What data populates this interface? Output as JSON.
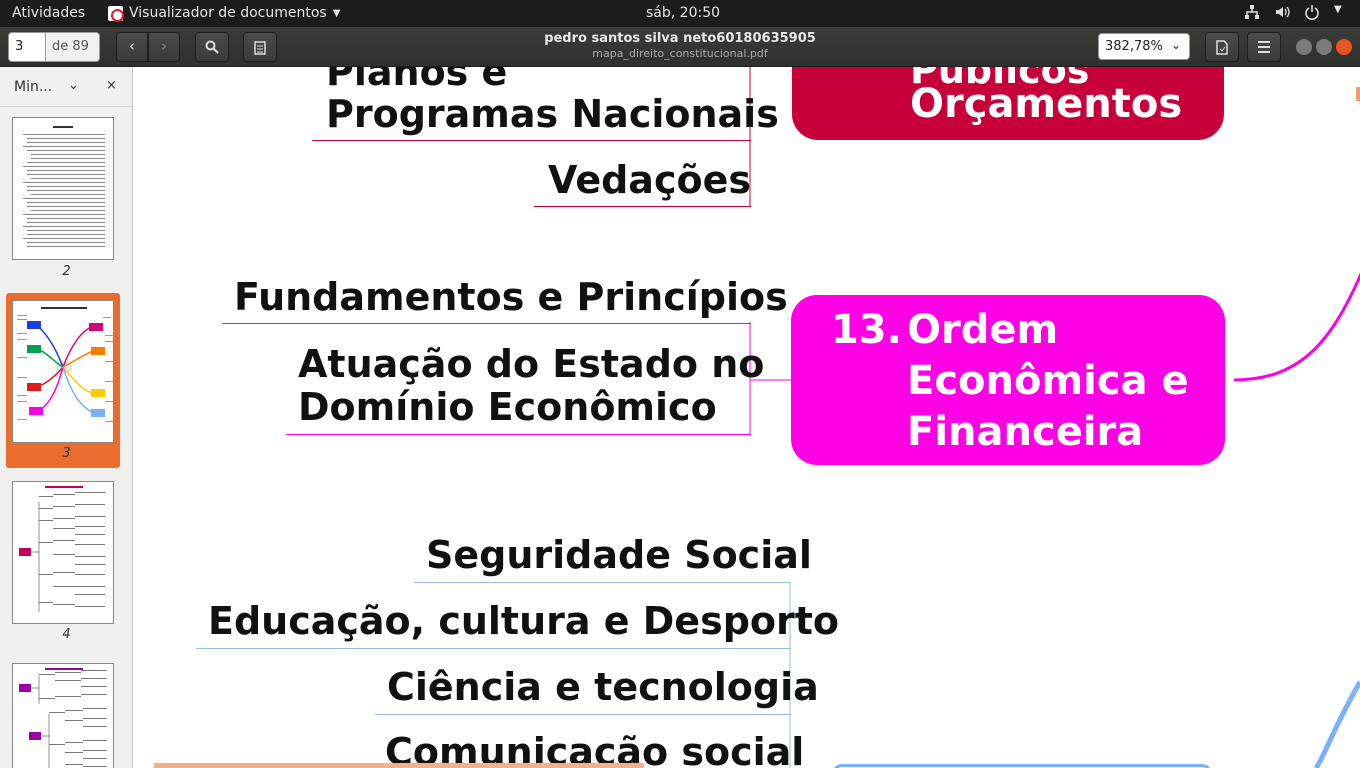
{
  "system_bar": {
    "activities": "Atividades",
    "app_name": "Visualizador de documentos",
    "clock": "sáb, 20:50"
  },
  "toolbar": {
    "page_current": "3",
    "page_total": "de 89",
    "doc_title": "pedro santos silva neto60180635905",
    "doc_filename": "mapa_direito_constitucional.pdf",
    "zoom": "382,78%"
  },
  "sidebar": {
    "view_select": "Min...",
    "thumbnails": [
      {
        "label": "2"
      },
      {
        "label": "3",
        "selected": true
      },
      {
        "label": "4"
      },
      {
        "label": ""
      }
    ]
  },
  "mindmap": {
    "top_leaves": [
      "Planos e",
      "Programas Nacionais",
      "Vedações"
    ],
    "top_node_lines": [
      "Públicos",
      "Orçamentos"
    ],
    "top_node_color": "#c8003a",
    "order_leaves": [
      "Fundamentos e Princípios",
      "Atuação do Estado no",
      "Domínio Econômico"
    ],
    "order_node": {
      "number": "13.",
      "line1": "Ordem",
      "line2": "Econômica e",
      "line3": "Financeira"
    },
    "order_node_color": "#ff00e6",
    "social_leaves": [
      "Seguridade Social",
      "Educação, cultura e Desporto",
      "Ciência e tecnologia",
      "Comunicação social"
    ]
  }
}
